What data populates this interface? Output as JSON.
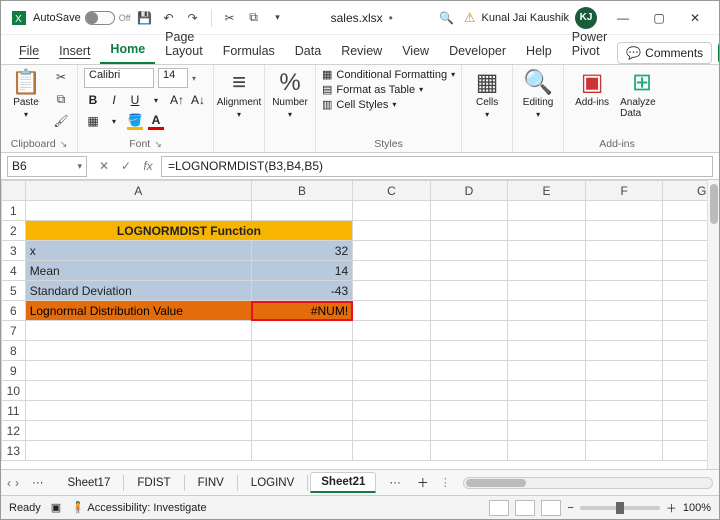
{
  "titlebar": {
    "autosave_label": "AutoSave",
    "autosave_state": "Off",
    "filename": "sales.xlsx",
    "saved_indicator": "•",
    "user_name": "Kunal Jai Kaushik",
    "user_initials": "KJ"
  },
  "menus": {
    "items": [
      "File",
      "Insert",
      "Home",
      "Page Layout",
      "Formulas",
      "Data",
      "Review",
      "View",
      "Developer",
      "Help",
      "Power Pivot"
    ],
    "active": "Home",
    "comments_label": "Comments"
  },
  "ribbon": {
    "clipboard_label": "Clipboard",
    "paste_label": "Paste",
    "font_label": "Font",
    "font_name": "Calibri",
    "font_size": "14",
    "alignment_label": "Alignment",
    "number_label": "Number",
    "styles_label": "Styles",
    "cond_fmt": "Conditional Formatting",
    "fmt_table": "Format as Table",
    "cell_styles": "Cell Styles",
    "cells_label": "Cells",
    "editing_label": "Editing",
    "addins_label": "Add-ins",
    "addins_btn": "Add-ins",
    "analyze_label": "Analyze Data"
  },
  "fbar": {
    "namebox": "B6",
    "formula": "=LOGNORMDIST(B3,B4,B5)"
  },
  "sheet": {
    "columns": [
      "A",
      "B",
      "C",
      "D",
      "E",
      "F",
      "G"
    ],
    "title": "LOGNORMDIST Function",
    "r3_a": "x",
    "r3_b": "32",
    "r4_a": "Mean",
    "r4_b": "14",
    "r5_a": "Standard Deviation",
    "r5_b": "-43",
    "r6_a": "Lognormal Distribution Value",
    "r6_b": "#NUM!"
  },
  "tabs": {
    "items": [
      "Sheet17",
      "FDIST",
      "FINV",
      "LOGINV",
      "Sheet21"
    ],
    "active": "Sheet21",
    "ellipsis_left": "···",
    "ellipsis_right": "···"
  },
  "status": {
    "ready": "Ready",
    "accessibility": "Accessibility: Investigate",
    "zoom": "100%"
  },
  "chart_data": {
    "type": "table",
    "title": "LOGNORMDIST Function",
    "rows": [
      {
        "label": "x",
        "value": 32
      },
      {
        "label": "Mean",
        "value": 14
      },
      {
        "label": "Standard Deviation",
        "value": -43
      },
      {
        "label": "Lognormal Distribution Value",
        "value": "#NUM!"
      }
    ],
    "formula_in_B6": "=LOGNORMDIST(B3,B4,B5)"
  }
}
